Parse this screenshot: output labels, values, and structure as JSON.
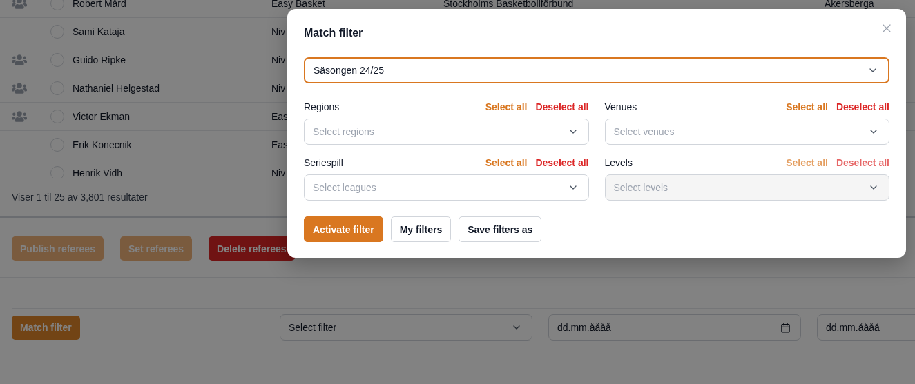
{
  "table": {
    "rows": [
      {
        "team": true,
        "selected": false,
        "name": "Robert Mård",
        "level": "Easy Basket",
        "federation": "Stockholms Basketbollförbund",
        "city": "Akersberga"
      },
      {
        "team": false,
        "selected": false,
        "name": "Sami Kataja",
        "level": "Niv"
      },
      {
        "team": true,
        "selected": false,
        "name": "Guido Ripke",
        "level": "Niv"
      },
      {
        "team": true,
        "selected": false,
        "name": "Nathaniel Helgestad",
        "level": "Niv"
      },
      {
        "team": true,
        "selected": false,
        "name": "Victor Ekman",
        "level": "Eas"
      },
      {
        "team": false,
        "selected": false,
        "name": "Erik Konecnik",
        "level": "Eas"
      },
      {
        "team": false,
        "selected": false,
        "name": "Henrik Vidh",
        "level": "Niv"
      }
    ],
    "footer": "Viser 1 til 25 av 3,801 resultater"
  },
  "actions": [
    {
      "label": "Publish referees",
      "kind": "primary"
    },
    {
      "label": "Set referees",
      "kind": "primary"
    },
    {
      "label": "Delete referees",
      "kind": "danger"
    }
  ],
  "filter_bar": {
    "button": "Match filter",
    "select": "Select filter",
    "date_from": "dd.mm.åååå",
    "date_to": "dd.mm.åååå"
  },
  "modal": {
    "title": "Match filter",
    "season": "Säsongen 24/25",
    "groups": [
      {
        "label": "Regions",
        "select_all": "Select all",
        "deselect_all": "Deselect all",
        "placeholder": "Select regions",
        "disabled": false
      },
      {
        "label": "Venues",
        "select_all": "Select all",
        "deselect_all": "Deselect all",
        "placeholder": "Select venues",
        "disabled": false
      },
      {
        "label": "Seriespill",
        "select_all": "Select all",
        "deselect_all": "Deselect all",
        "placeholder": "Select leagues",
        "disabled": false
      },
      {
        "label": "Levels",
        "select_all": "Select all",
        "deselect_all": "Deselect all",
        "placeholder": "Select levels",
        "disabled": true
      }
    ],
    "buttons": [
      {
        "label": "Activate filter",
        "kind": "primary"
      },
      {
        "label": "My filters",
        "kind": "outline"
      },
      {
        "label": "Save filters as",
        "kind": "outline"
      }
    ]
  }
}
